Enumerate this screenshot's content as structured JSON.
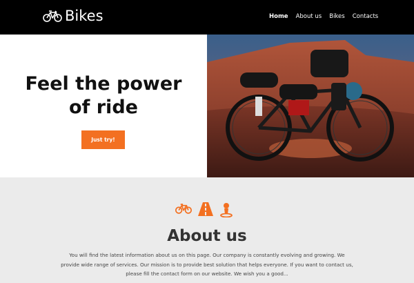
{
  "header": {
    "logo_text": "Bikes",
    "logo_icon": "bicycle-icon",
    "nav": [
      {
        "label": "Home",
        "active": true
      },
      {
        "label": "About us",
        "active": false
      },
      {
        "label": "Bikes",
        "active": false
      },
      {
        "label": "Contacts",
        "active": false
      }
    ]
  },
  "hero": {
    "title_line1": "Feel the power",
    "title_line2": "of ride",
    "cta_label": "Just try!",
    "image": "loaded-gravel-bike-in-red-desert-photo"
  },
  "about": {
    "icons": [
      "bicycle-icon",
      "road-icon",
      "location-pin-icon"
    ],
    "title": "About us",
    "text": "You will find the latest information about us on this page. Our company is constantly evolving and growing. We provide wide range of services. Our mission is to provide best solution that helps everyone. If you want to contact us, please fill the contact form on our website. We wish you a good..."
  },
  "colors": {
    "header_bg": "#000000",
    "accent": "#f37021",
    "about_bg": "#ebebeb"
  }
}
